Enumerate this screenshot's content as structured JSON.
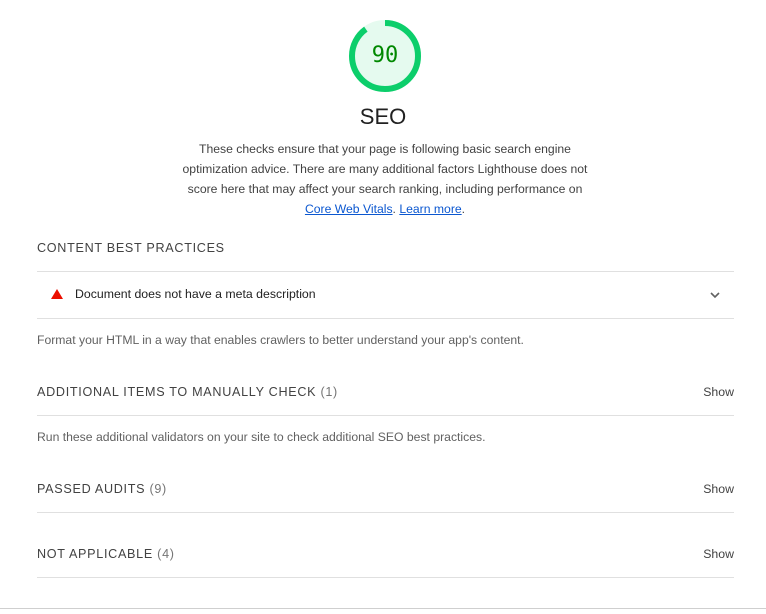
{
  "category": {
    "score": "90",
    "score_fraction": 0.9,
    "title": "SEO",
    "description_text": "These checks ensure that your page is following basic search engine optimization advice. There are many additional factors Lighthouse does not score here that may affect your search ranking, including performance on",
    "link_core_web_vitals": "Core Web Vitals",
    "separator": ".",
    "link_learn_more": "Learn more",
    "end_period": "."
  },
  "colors": {
    "pass_green": "#0cce6b",
    "pass_green_fill": "#e5faef",
    "pass_text": "#008800",
    "fail_red": "#eb0f00",
    "link_blue": "#0b57d0"
  },
  "groups": {
    "content": {
      "title": "CONTENT BEST PRACTICES",
      "audit": {
        "icon": "fail-triangle-icon",
        "title": "Document does not have a meta description"
      },
      "description": "Format your HTML in a way that enables crawlers to better understand your app's content."
    },
    "manual": {
      "title": "ADDITIONAL ITEMS TO MANUALLY CHECK",
      "count": "(1)",
      "toggle": "Show",
      "description": "Run these additional validators on your site to check additional SEO best practices."
    },
    "passed": {
      "title": "PASSED AUDITS",
      "count": "(9)",
      "toggle": "Show"
    },
    "not_applicable": {
      "title": "NOT APPLICABLE",
      "count": "(4)",
      "toggle": "Show"
    }
  }
}
